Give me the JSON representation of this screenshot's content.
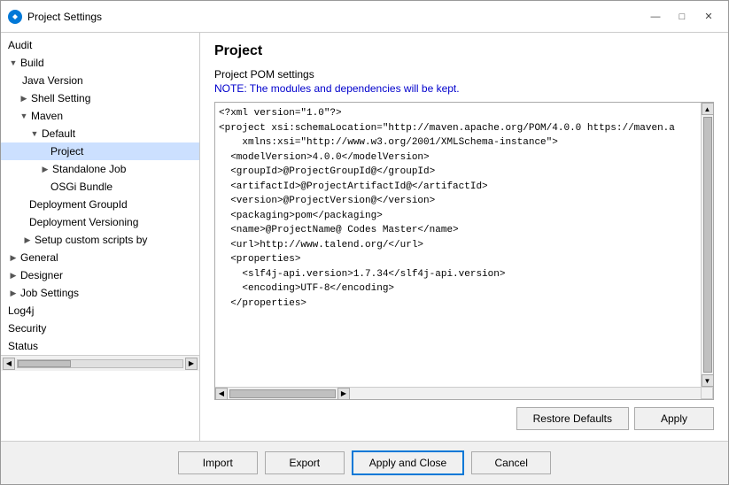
{
  "window": {
    "title": "Project Settings",
    "icon_label": "P"
  },
  "title_bar": {
    "minimize_label": "—",
    "maximize_label": "□",
    "close_label": "✕"
  },
  "sidebar": {
    "items": [
      {
        "id": "audit",
        "label": "Audit",
        "level": 0,
        "expandable": false,
        "expanded": false,
        "selected": false
      },
      {
        "id": "build",
        "label": "Build",
        "level": 0,
        "expandable": true,
        "expanded": true,
        "selected": false
      },
      {
        "id": "java-version",
        "label": "Java Version",
        "level": 1,
        "expandable": false,
        "expanded": false,
        "selected": false
      },
      {
        "id": "shell-setting",
        "label": "Shell Setting",
        "level": 1,
        "expandable": true,
        "expanded": false,
        "selected": false
      },
      {
        "id": "maven",
        "label": "Maven",
        "level": 1,
        "expandable": true,
        "expanded": true,
        "selected": false
      },
      {
        "id": "default",
        "label": "Default",
        "level": 2,
        "expandable": true,
        "expanded": true,
        "selected": false
      },
      {
        "id": "project",
        "label": "Project",
        "level": 3,
        "expandable": false,
        "expanded": false,
        "selected": true
      },
      {
        "id": "standalone-job",
        "label": "Standalone Job",
        "level": 3,
        "expandable": true,
        "expanded": false,
        "selected": false
      },
      {
        "id": "osgi-bundle",
        "label": "OSGi Bundle",
        "level": 3,
        "expandable": false,
        "expanded": false,
        "selected": false
      },
      {
        "id": "deployment-groupid",
        "label": "Deployment GroupId",
        "level": 2,
        "expandable": false,
        "expanded": false,
        "selected": false
      },
      {
        "id": "deployment-versioning",
        "label": "Deployment Versioning",
        "level": 2,
        "expandable": false,
        "expanded": false,
        "selected": false
      },
      {
        "id": "setup-custom",
        "label": "Setup custom scripts by",
        "level": 2,
        "expandable": true,
        "expanded": false,
        "selected": false
      },
      {
        "id": "general",
        "label": "General",
        "level": 0,
        "expandable": true,
        "expanded": false,
        "selected": false
      },
      {
        "id": "designer",
        "label": "Designer",
        "level": 0,
        "expandable": true,
        "expanded": false,
        "selected": false
      },
      {
        "id": "job-settings",
        "label": "Job Settings",
        "level": 0,
        "expandable": true,
        "expanded": false,
        "selected": false
      },
      {
        "id": "log4j",
        "label": "Log4j",
        "level": 0,
        "expandable": false,
        "expanded": false,
        "selected": false
      },
      {
        "id": "security",
        "label": "Security",
        "level": 0,
        "expandable": false,
        "expanded": false,
        "selected": false
      },
      {
        "id": "status",
        "label": "Status",
        "level": 0,
        "expandable": false,
        "expanded": false,
        "selected": false
      }
    ]
  },
  "content": {
    "title": "Project",
    "subtitle": "Project POM settings",
    "note": "NOTE: The modules and dependencies will be kept.",
    "xml_content": "<?xml version=\"1.0\"?>\n<project xsi:schemaLocation=\"http://maven.apache.org/POM/4.0.0 https://maven.a\n    xmlns:xsi=\"http://www.w3.org/2001/XMLSchema-instance\">\n  <modelVersion>4.0.0</modelVersion>\n  <groupId>@ProjectGroupId@</groupId>\n  <artifactId>@ProjectArtifactId@</artifactId>\n  <version>@ProjectVersion@</version>\n  <packaging>pom</packaging>\n  <name>@ProjectName@ Codes Master</name>\n  <url>http://www.talend.org/</url>\n  <properties>\n    <slf4j-api.version>1.7.34</slf4j-api.version>\n    <encoding>UTF-8</encoding>\n  </properties>",
    "restore_defaults_label": "Restore Defaults",
    "apply_label": "Apply"
  },
  "bottom_bar": {
    "import_label": "Import",
    "export_label": "Export",
    "apply_close_label": "Apply and Close",
    "cancel_label": "Cancel"
  }
}
